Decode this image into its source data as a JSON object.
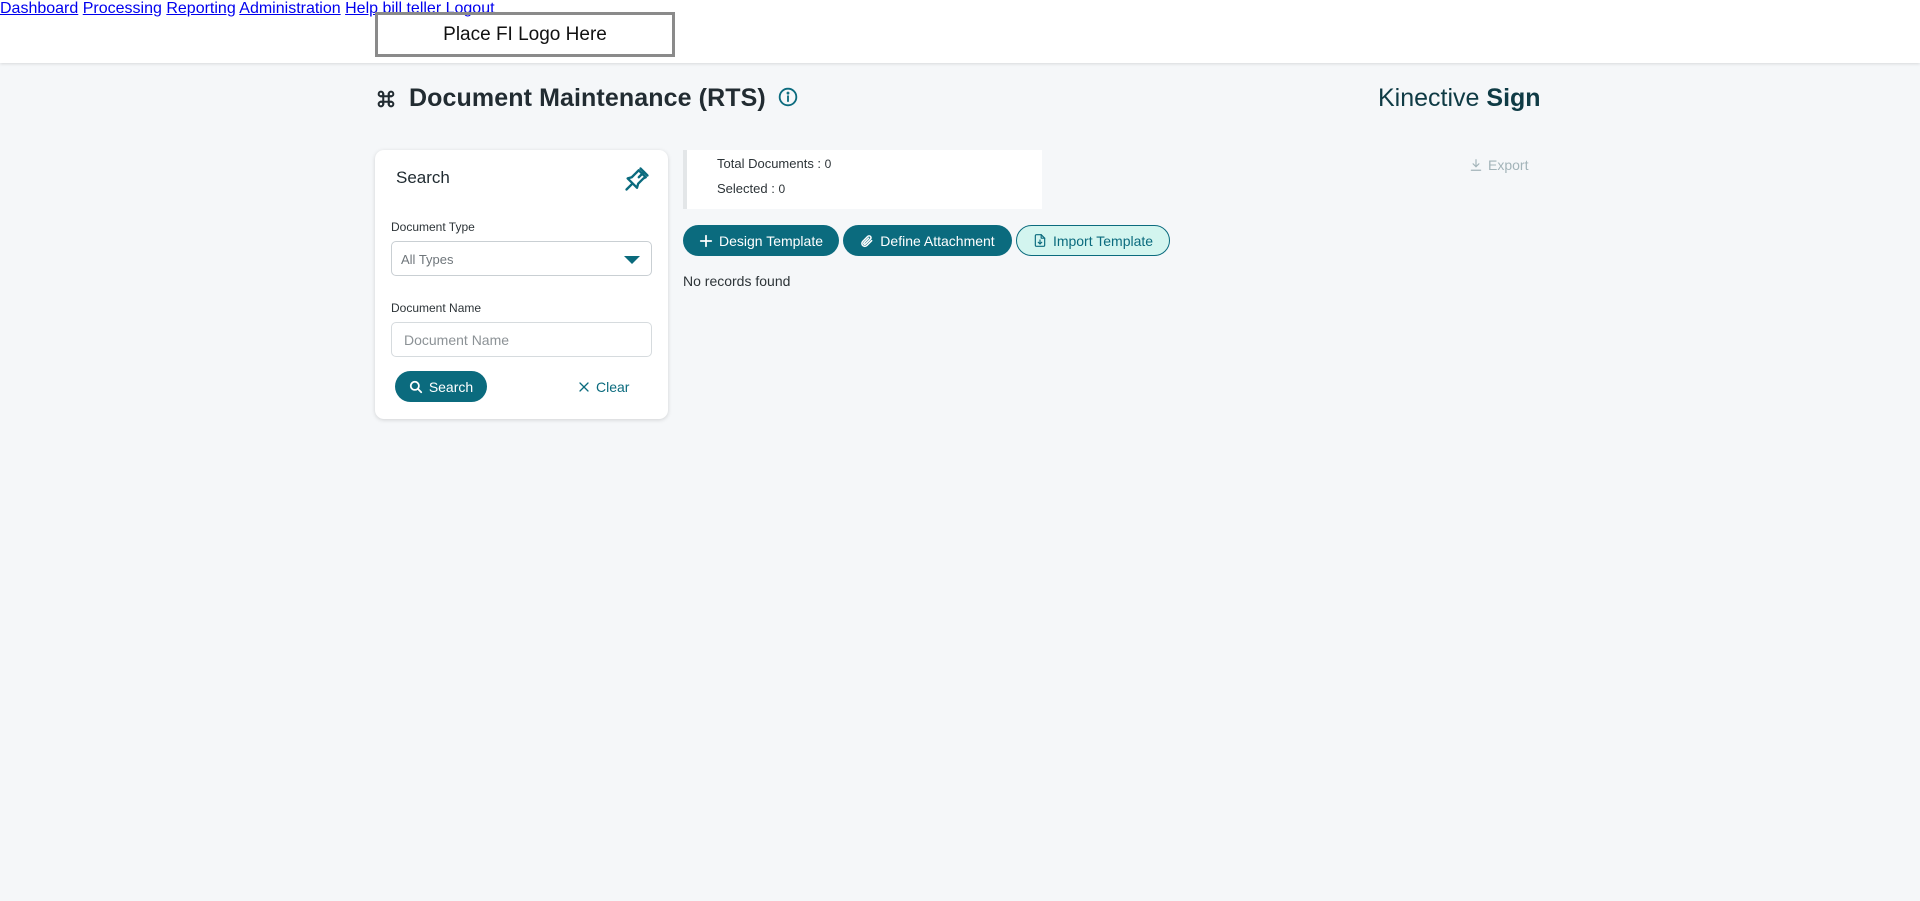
{
  "header": {
    "logo_text": "Place FI Logo Here",
    "nav": [
      {
        "label": "Dashboard"
      },
      {
        "label": "Processing"
      },
      {
        "label": "Reporting"
      },
      {
        "label": "Administration"
      },
      {
        "label": "Help"
      },
      {
        "label": "bill teller"
      },
      {
        "label": "Logout"
      }
    ]
  },
  "page": {
    "title": "Document Maintenance (RTS)",
    "title_icon": "command-icon",
    "info_icon": "info-icon",
    "brand_prefix": "Kinective",
    "brand_suffix": "Sign"
  },
  "search_panel": {
    "title": "Search",
    "pin_icon": "pin-icon",
    "document_type_label": "Document Type",
    "document_type_value": "All Types",
    "document_name_label": "Document Name",
    "document_name_placeholder": "Document Name",
    "document_name_value": "",
    "search_button": "Search",
    "clear_button": "Clear"
  },
  "stats": {
    "total_label": "Total Documents : ",
    "total_value": "0",
    "selected_label": "Selected : ",
    "selected_value": "0"
  },
  "toolbar": {
    "export_label": "Export",
    "design_template_label": "Design Template",
    "define_attachment_label": "Define Attachment",
    "import_template_label": "Import Template"
  },
  "results": {
    "empty_message": "No records found"
  },
  "colors": {
    "accent": "#0b6b7e",
    "accent_light": "#d3f5ef",
    "background": "#f5f7f9",
    "export_disabled": "#a3b4b9"
  }
}
